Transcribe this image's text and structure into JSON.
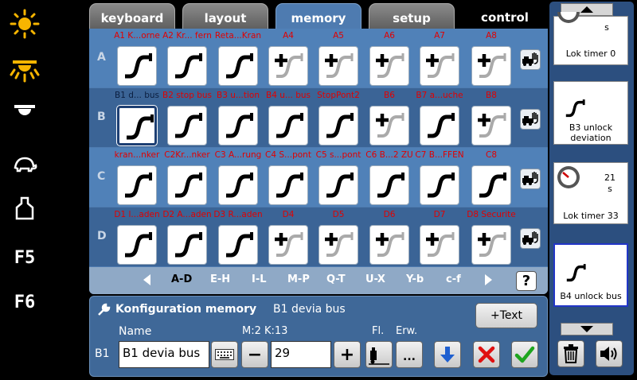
{
  "sidebar": {
    "icons": [
      "sun-bright-icon",
      "sun-dim-icon",
      "dome-light-icon",
      "turtle-icon",
      "weight-icon"
    ],
    "f5": "F5",
    "f6": "F6"
  },
  "tabs": [
    {
      "label": "keyboard",
      "active": false
    },
    {
      "label": "layout",
      "active": false
    },
    {
      "label": "memory",
      "active": true
    },
    {
      "label": "setup",
      "active": false
    },
    {
      "label": "control",
      "active": false
    }
  ],
  "rows": [
    {
      "letter": "A",
      "slots": [
        {
          "label": "A1 K...orne",
          "type": "straight"
        },
        {
          "label": "A2 Kr... fern",
          "type": "straight"
        },
        {
          "label": "Reta...Kran",
          "type": "straight"
        },
        {
          "label": "A4",
          "type": "plus"
        },
        {
          "label": "A5",
          "type": "plus"
        },
        {
          "label": "A6",
          "type": "plus"
        },
        {
          "label": "A7",
          "type": "plus"
        },
        {
          "label": "A8",
          "type": "plus"
        }
      ]
    },
    {
      "letter": "B",
      "slots": [
        {
          "label": "B1 d... bus",
          "type": "straight",
          "selected": true
        },
        {
          "label": "B2 stop bus",
          "type": "straight"
        },
        {
          "label": "B3 u...tion",
          "type": "straight"
        },
        {
          "label": "B4 u... bus",
          "type": "straight"
        },
        {
          "label": "StopPont2",
          "type": "straight"
        },
        {
          "label": "B6",
          "type": "plus"
        },
        {
          "label": "B7 a...uche",
          "type": "straight"
        },
        {
          "label": "B8",
          "type": "plus"
        }
      ]
    },
    {
      "letter": "C",
      "slots": [
        {
          "label": "kran...nker",
          "type": "straight"
        },
        {
          "label": "C2Kr...nker",
          "type": "straight"
        },
        {
          "label": "C3 A...rung",
          "type": "straight"
        },
        {
          "label": "C4 S...pont",
          "type": "straight"
        },
        {
          "label": "C5 s...pont",
          "type": "straight"
        },
        {
          "label": "C6 B...2 ZU",
          "type": "straight"
        },
        {
          "label": "C7 B...FFEN",
          "type": "straight"
        },
        {
          "label": "C8",
          "type": "straight"
        }
      ]
    },
    {
      "letter": "D",
      "slots": [
        {
          "label": "D1 l...aden",
          "type": "straight"
        },
        {
          "label": "D2 A...aden",
          "type": "straight"
        },
        {
          "label": "D3 R...aden",
          "type": "straight"
        },
        {
          "label": "D4",
          "type": "plus"
        },
        {
          "label": "D5",
          "type": "plus"
        },
        {
          "label": "D6",
          "type": "plus"
        },
        {
          "label": "D7",
          "type": "plus"
        },
        {
          "label": "D8 Securite",
          "type": "plus"
        }
      ]
    }
  ],
  "pager": {
    "pages": [
      "A-D",
      "E-H",
      "I-L",
      "M-P",
      "Q-T",
      "U-X",
      "Y-b",
      "c-f"
    ],
    "active": "A-D",
    "help": "?"
  },
  "config": {
    "title": "Konfiguration memory",
    "subtitle": "B1 devia bus",
    "add_text": "+Text",
    "name_label": "Name",
    "mk_label": "M:2 K:13",
    "fl_label": "Fl.",
    "erw_label": "Erw.",
    "slot_id": "B1",
    "name_value": "B1 devia bus",
    "number_value": "29",
    "minus": "−",
    "plus": "+",
    "erw_value": "..."
  },
  "right": {
    "cards": [
      {
        "seconds": "s",
        "label": "Lok timer 0",
        "type": "timer-partial"
      },
      {
        "label": "B3 unlock deviation",
        "type": "memory"
      },
      {
        "seconds": "21",
        "unit": "s",
        "label": "Lok timer 33",
        "type": "timer"
      },
      {
        "label": "B4 unlock bus",
        "type": "memory",
        "selected": true
      }
    ]
  },
  "colors": {
    "accent": "#4e7bb0",
    "label_red": "#e10000",
    "ok_green": "#1ea51e",
    "cancel_red": "#e01010",
    "down_blue": "#1e5fd0"
  }
}
